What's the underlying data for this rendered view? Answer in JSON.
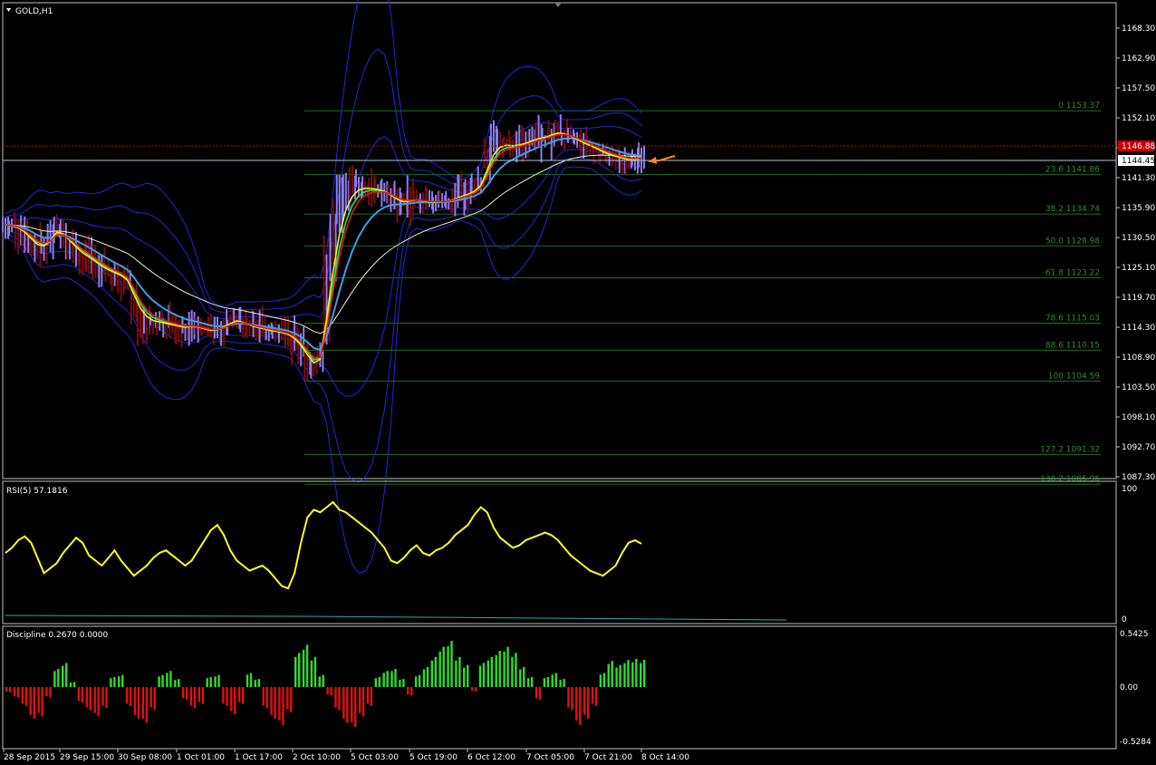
{
  "symbol": "GOLD,H1",
  "colors": {
    "background": "#000000",
    "frame": "#c0c0c0",
    "price_bull": "#8d7cf0",
    "price_bear": "#7a0c12",
    "bands": "#1b2bd6",
    "ema_slow": "#f2efc8",
    "ema_mid": "#3aa0e6",
    "ribbon_red": "#e01818",
    "ribbon_yellow": "#f4f400",
    "ribbon_green": "#36e24a",
    "fib": "#1f6e1f",
    "bid_line": "#c80000",
    "ask_line": "#b0c8d8",
    "rsi": "#ffff1f",
    "rsi_ma": "#1fb0b0",
    "disc_pos": "#2edc2e",
    "disc_neg": "#e01010",
    "arrow": "#ff8a1a"
  },
  "main_panel": {
    "price_axis_labels": [
      "1168.30",
      "1162.90",
      "1157.50",
      "1152.10",
      "1146.70",
      "1141.30",
      "1135.90",
      "1130.50",
      "1125.10",
      "1119.70",
      "1114.30",
      "1108.90",
      "1103.50",
      "1098.10",
      "1092.70",
      "1087.30"
    ],
    "bid_price": "1146.88",
    "ask_price": "1144.45",
    "fib_levels": [
      {
        "label": "0 1153.37",
        "price": 1153.37
      },
      {
        "label": "23.6 1141.86",
        "price": 1141.86
      },
      {
        "label": "38.2 1134.74",
        "price": 1134.74
      },
      {
        "label": "50.0 1128.98",
        "price": 1128.98
      },
      {
        "label": "61.8 1123.22",
        "price": 1123.22
      },
      {
        "label": "78.6 1115.03",
        "price": 1115.03
      },
      {
        "label": "88.6 1110.15",
        "price": 1110.15
      },
      {
        "label": "100 1104.59",
        "price": 1104.59
      },
      {
        "label": "127.2 1091.32",
        "price": 1091.32
      },
      {
        "label": "138.2 1085.96",
        "price": 1085.96
      }
    ]
  },
  "rsi_panel": {
    "title": "RSI(5) 57.1816",
    "axis_labels": [
      "100",
      "0"
    ]
  },
  "discipline_panel": {
    "title": "Discipline 0.2670 0.0000",
    "axis_labels": [
      "0.5425",
      "0.00",
      "-0.5284"
    ]
  },
  "time_axis_labels": [
    "28 Sep 2015",
    "29 Sep 15:00",
    "30 Sep 08:00",
    "1 Oct 01:00",
    "1 Oct 17:00",
    "2 Oct 10:00",
    "5 Oct 03:00",
    "5 Oct 19:00",
    "6 Oct 12:00",
    "7 Oct 05:00",
    "7 Oct 21:00",
    "8 Oct 14:00"
  ],
  "chart_data": {
    "type": "line",
    "title": "GOLD,H1",
    "ylim": [
      1085,
      1171
    ],
    "x": [
      "28 Sep 2015",
      "29 Sep 15:00",
      "30 Sep 08:00",
      "1 Oct 01:00",
      "1 Oct 17:00",
      "2 Oct 10:00",
      "5 Oct 03:00",
      "5 Oct 19:00",
      "6 Oct 12:00",
      "7 Oct 05:00",
      "7 Oct 21:00",
      "8 Oct 14:00"
    ],
    "grid": false,
    "series": [
      {
        "name": "GOLD,H1",
        "values": [
          1132.8,
          1132.4,
          1132.0,
          1131.0,
          1129.5,
          1128.5,
          1128.8,
          1130.5,
          1132.5,
          1131.0,
          1129.2,
          1128.0,
          1127.0,
          1126.5,
          1125.6,
          1124.8,
          1124.2,
          1123.8,
          1123.3,
          1122.2,
          1118.5,
          1116.0,
          1115.2,
          1115.0,
          1115.1,
          1114.8,
          1114.6,
          1114.3,
          1114.2,
          1114.5,
          1114.3,
          1113.8,
          1113.5,
          1113.9,
          1114.6,
          1115.4,
          1115.8,
          1115.0,
          1114.4,
          1114.1,
          1113.9,
          1113.6,
          1113.4,
          1113.2,
          1112.8,
          1111.8,
          1110.2,
          1108.2,
          1106.8,
          1109.0,
          1121.0,
          1130.2,
          1135.8,
          1138.6,
          1139.6,
          1139.9,
          1139.6,
          1139.3,
          1139.0,
          1138.6,
          1137.7,
          1136.9,
          1136.6,
          1137.2,
          1137.4,
          1137.0,
          1136.8,
          1136.9,
          1137.0,
          1137.2,
          1137.7,
          1138.2,
          1138.6,
          1139.2,
          1140.6,
          1144.6,
          1147.4,
          1147.8,
          1147.4,
          1147.0,
          1147.3,
          1147.7,
          1148.3,
          1148.6,
          1148.7,
          1149.3,
          1149.6,
          1149.1,
          1148.6,
          1147.8,
          1147.2,
          1146.7,
          1146.2,
          1145.6,
          1145.2,
          1144.9,
          1144.6,
          1144.4,
          1144.6,
          1145.2
        ]
      },
      {
        "name": "",
        "values": []
      }
    ],
    "rsi": [
      50,
      54,
      60,
      63,
      58,
      46,
      34,
      38,
      42,
      50,
      56,
      62,
      58,
      48,
      44,
      40,
      46,
      52,
      44,
      38,
      32,
      36,
      40,
      46,
      50,
      52,
      48,
      44,
      40,
      44,
      52,
      60,
      68,
      72,
      64,
      52,
      44,
      40,
      36,
      38,
      40,
      36,
      30,
      24,
      22,
      34,
      58,
      78,
      84,
      82,
      86,
      90,
      84,
      82,
      78,
      74,
      70,
      66,
      60,
      54,
      44,
      42,
      46,
      52,
      56,
      50,
      48,
      52,
      54,
      58,
      64,
      68,
      72,
      80,
      86,
      82,
      70,
      62,
      58,
      54,
      56,
      60,
      62,
      64,
      66,
      64,
      60,
      54,
      48,
      44,
      40,
      36,
      34,
      32,
      36,
      40,
      50,
      58,
      60,
      57.18
    ],
    "discipline": [
      -0.05,
      -0.1,
      -0.18,
      -0.3,
      -0.28,
      -0.1,
      0.18,
      0.24,
      0.05,
      -0.15,
      -0.22,
      -0.28,
      -0.2,
      0.1,
      0.12,
      -0.18,
      -0.3,
      -0.34,
      -0.22,
      0.12,
      0.16,
      0.08,
      -0.12,
      -0.2,
      -0.16,
      0.1,
      0.12,
      -0.18,
      -0.26,
      -0.16,
      0.14,
      0.08,
      -0.2,
      -0.3,
      -0.36,
      -0.24,
      0.34,
      0.42,
      0.3,
      0.12,
      -0.08,
      -0.22,
      -0.34,
      -0.38,
      -0.28,
      -0.18,
      0.1,
      0.16,
      0.18,
      0.08,
      -0.08,
      0.12,
      0.2,
      0.3,
      0.4,
      0.46,
      0.3,
      0.22,
      -0.04,
      0.24,
      0.3,
      0.36,
      0.4,
      0.34,
      0.2,
      0.1,
      -0.12,
      0.1,
      0.14,
      0.08,
      -0.22,
      -0.36,
      -0.3,
      -0.18,
      0.14,
      0.26,
      0.22,
      0.27,
      0.28,
      0.27
    ]
  }
}
